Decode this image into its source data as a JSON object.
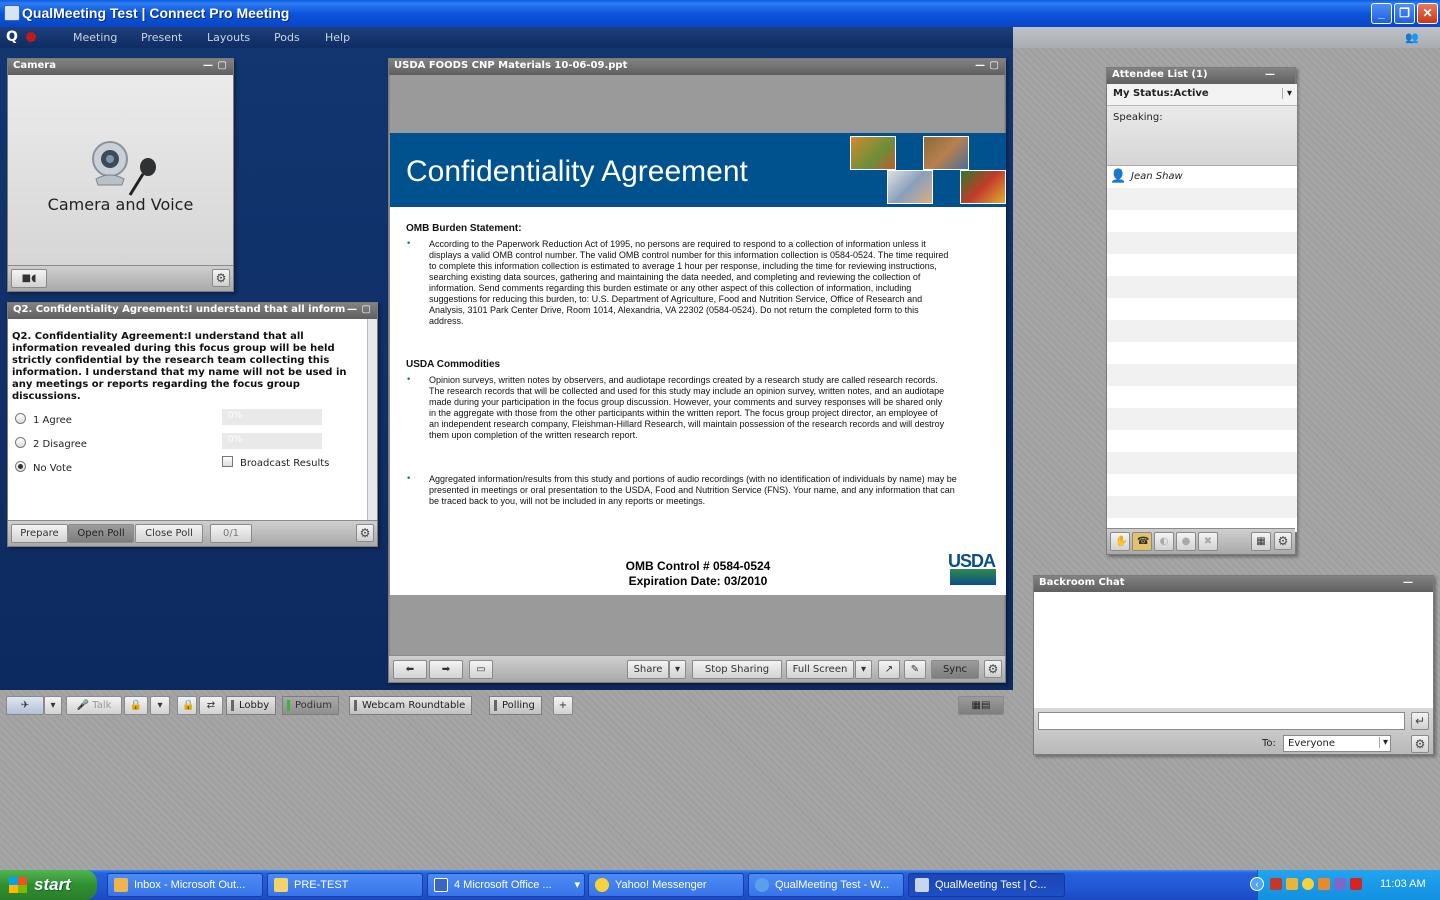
{
  "window": {
    "title": "QualMeeting Test | Connect Pro Meeting",
    "min": "_",
    "max": "❐",
    "close": "✕"
  },
  "menu": {
    "logo": "Q",
    "items": [
      "Meeting",
      "Present",
      "Layouts",
      "Pods",
      "Help"
    ]
  },
  "camera_pod": {
    "title": "Camera",
    "label": "Camera and Voice"
  },
  "poll_pod": {
    "title": "Q2. Confidentiality Agreement:I understand that all inform",
    "question": "Q2. Confidentiality Agreement:I understand that all information revealed during this focus group will be held strictly confidential by the research team collecting this information.  I understand that my name will not be used in any meetings or reports regarding the focus group discussions.",
    "options": [
      {
        "label": "1 Agree",
        "pct": "0%",
        "selected": false
      },
      {
        "label": "2 Disagree",
        "pct": "0%",
        "selected": false
      },
      {
        "label": "No Vote",
        "selected": true
      }
    ],
    "broadcast_label": "Broadcast Results",
    "buttons": {
      "prepare": "Prepare",
      "open": "Open Poll",
      "close": "Close Poll",
      "count": "0/1"
    }
  },
  "share_pod": {
    "title": "USDA FOODS CNP Materials 10-06-09.ppt",
    "slide": {
      "title": "Confidentiality Agreement",
      "h1": "OMB Burden Statement:",
      "p1": "According to the Paperwork Reduction Act of 1995, no persons are required to respond to a collection of information unless it displays a valid OMB control number.  The valid OMB control number for this information collection is 0584-0524.  The time required to complete this information collection is estimated to average 1 hour per response, including the time for reviewing instructions, searching existing data sources, gathering and maintaining the data needed, and completing and reviewing the collection of information.  Send comments regarding this burden estimate or any other aspect of this collection of information, including suggestions for reducing this burden, to:  U.S. Department of Agriculture, Food and Nutrition Service, Office of Research and Analysis, 3101 Park Center Drive, Room 1014, Alexandria, VA 22302 (0584-0524).  Do not return the completed form to this address.",
      "h2": "USDA Commodities",
      "p2": " Opinion surveys, written notes by observers, and audiotape recordings created by a research study are called research records.  The research records that will be collected and used for this study may include an opinion survey, written notes, and an audiotape made during your participation in the focus group discussion.  However, your comments and survey responses will be shared only in the aggregate with those from the other participants within the written report.  The focus group project director, an employee of an independent research company, Fleishman-Hillard Research, will maintain possession of the research records and will destroy them upon completion of the written research report.",
      "p3": "Aggregated information/results from this study and portions of audio recordings (with no identification of individuals by name) may be presented in meetings or oral presentation to the USDA, Food and Nutrition Service (FNS).  Your name, and any information that can be traced back to you, will not be included in any reports or meetings.",
      "omb1": "OMB Control # 0584-0524",
      "omb2": "Expiration Date:  03/2010",
      "logo": "USDA"
    },
    "toolbar": {
      "share": "Share",
      "stop": "Stop Sharing",
      "full": "Full Screen",
      "sync": "Sync"
    }
  },
  "attendee_pod": {
    "title": "Attendee List (1)",
    "status": "My Status:Active",
    "speaking": "Speaking:",
    "attendees": [
      "Jean Shaw"
    ]
  },
  "chat_pod": {
    "title": "Backroom Chat",
    "to_label": "To:",
    "to_value": "Everyone"
  },
  "layout_bar": {
    "talk": "Talk",
    "tabs": [
      "Lobby",
      "Podium",
      "Webcam Roundtable",
      "Polling"
    ],
    "active_tab": "Podium",
    "add": "+"
  },
  "taskbar": {
    "start": "start",
    "tasks": [
      "Inbox - Microsoft Out...",
      "PRE-TEST",
      "4 Microsoft Office ...",
      "Yahoo! Messenger",
      "QualMeeting Test - W...",
      "QualMeeting Test | C..."
    ],
    "clock": "11:03 AM"
  }
}
